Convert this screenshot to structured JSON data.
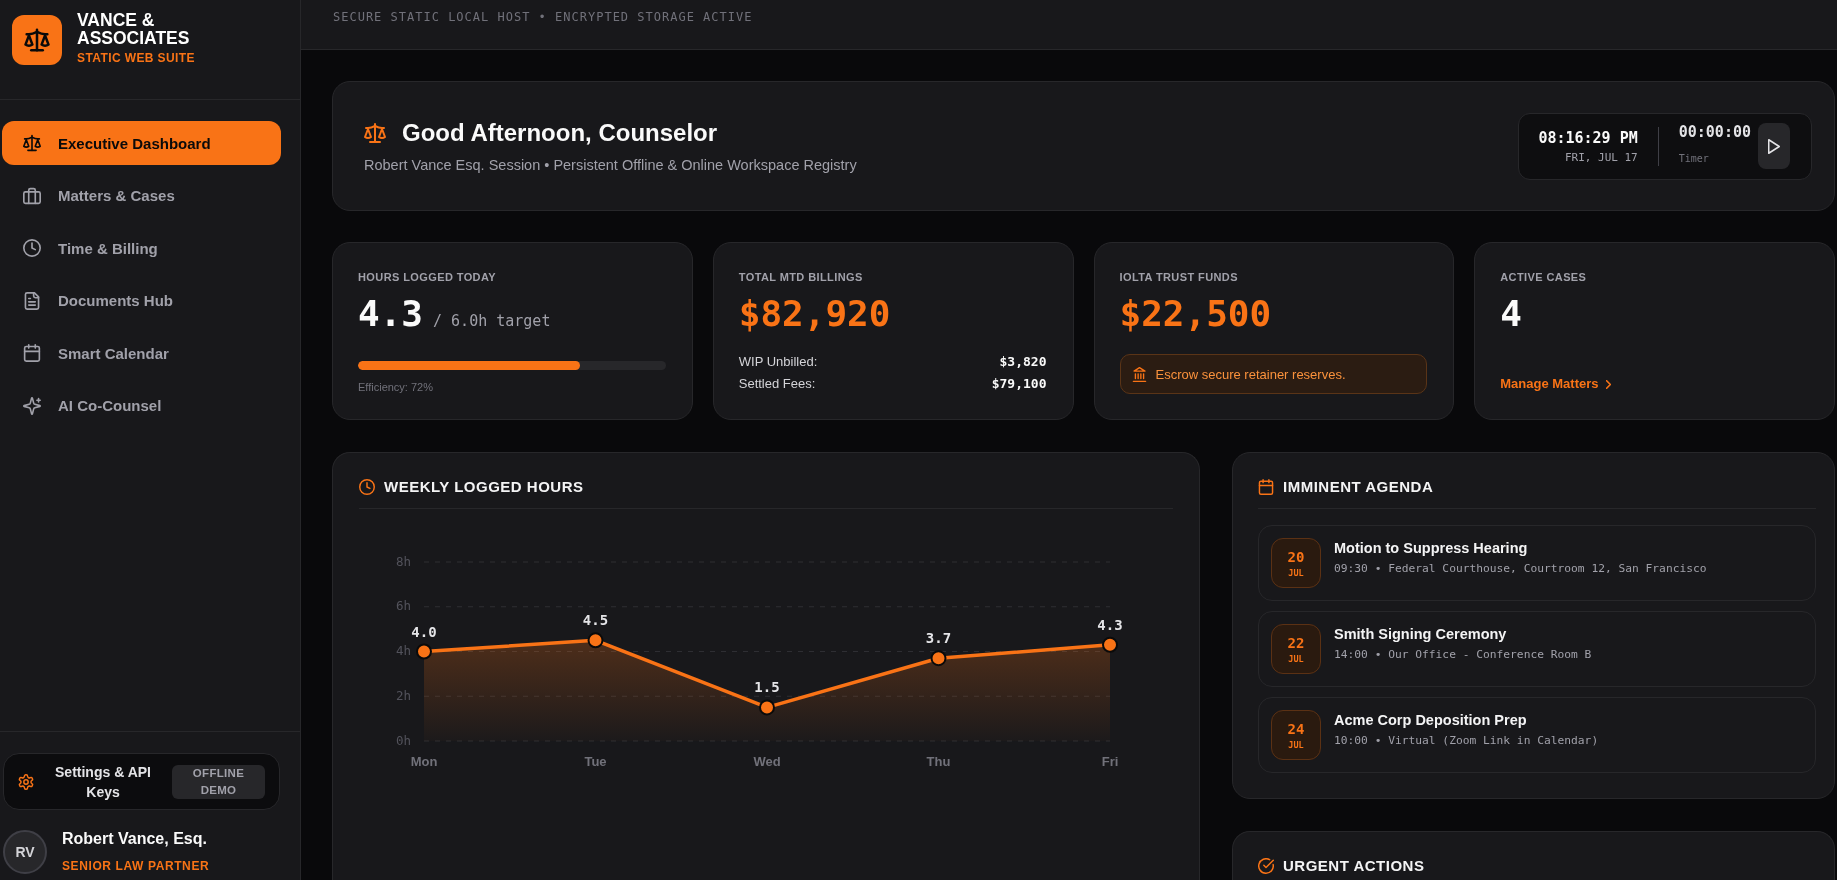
{
  "sidebar": {
    "brand": {
      "name": "VANCE & ASSOCIATES",
      "tagline": "STATIC WEB SUITE"
    },
    "nav": [
      {
        "label": "Executive Dashboard",
        "selected": true
      },
      {
        "label": "Matters & Cases",
        "selected": false
      },
      {
        "label": "Time & Billing",
        "selected": false
      },
      {
        "label": "Documents Hub",
        "selected": false
      },
      {
        "label": "Smart Calendar",
        "selected": false
      },
      {
        "label": "AI Co-Counsel",
        "selected": false
      }
    ],
    "settings": {
      "label": "Settings & API Keys",
      "badge": "OFFLINE DEMO"
    },
    "user": {
      "initials": "RV",
      "name": "Robert Vance, Esq.",
      "role": "SENIOR LAW PARTNER"
    }
  },
  "top_bar": {
    "status": "SECURE STATIC LOCAL HOST • ENCRYPTED STORAGE ACTIVE"
  },
  "greeting": {
    "title": "Good Afternoon, Counselor",
    "subtitle": "Robert Vance Esq. Session • Persistent Offline & Online Workspace Registry",
    "clock": {
      "time": "08:16:29 PM",
      "date": "FRI, JUL 17"
    },
    "timer": {
      "value": "00:00:00",
      "label": "Timer"
    }
  },
  "stats": [
    {
      "kind": "progress",
      "label": "HOURS LOGGED TODAY",
      "value": "4.3",
      "unit": "/ 6.0h target",
      "level": 0.72,
      "caption": "Efficiency: 72%"
    },
    {
      "kind": "breakdown",
      "label": "TOTAL MTD BILLINGS",
      "value": "$82,920",
      "rows": [
        {
          "label": "WIP Unbilled:",
          "value": "$3,820"
        },
        {
          "label": "Settled Fees:",
          "value": "$79,100"
        }
      ]
    },
    {
      "kind": "notice",
      "label": "IOLTA TRUST FUNDS",
      "value": "$22,500",
      "notice": "Escrow secure retainer reserves."
    },
    {
      "kind": "link",
      "label": "ACTIVE CASES",
      "value": "4",
      "link": "Manage Matters"
    }
  ],
  "weekly_hours": {
    "title": "WEEKLY LOGGED HOURS",
    "chart_data": {
      "type": "area",
      "categories": [
        "Mon",
        "Tue",
        "Wed",
        "Thu",
        "Fri"
      ],
      "series": [
        {
          "color": "#f97316",
          "values": [
            4.0,
            4.5,
            1.5,
            3.7,
            4.3
          ]
        }
      ],
      "ylim": [
        0,
        8
      ],
      "yticks": [
        {
          "value": 0,
          "label": "0h"
        },
        {
          "value": 2,
          "label": "2h"
        },
        {
          "value": 4,
          "label": "4h"
        },
        {
          "value": 6,
          "label": "6h"
        },
        {
          "value": 8,
          "label": "8h"
        }
      ],
      "grid": true,
      "value_labels": [
        "4.0",
        "4.5",
        "1.5",
        "3.7",
        "4.3"
      ]
    }
  },
  "agenda": {
    "title": "IMMINENT AGENDA",
    "items": [
      {
        "day": "20",
        "month": "JUL",
        "title": "Motion to Suppress Hearing",
        "detail": "09:30 • Federal Courthouse, Courtroom 12, San Francisco"
      },
      {
        "day": "22",
        "month": "JUL",
        "title": "Smith Signing Ceremony",
        "detail": "14:00 • Our Office - Conference Room B"
      },
      {
        "day": "24",
        "month": "JUL",
        "title": "Acme Corp Deposition Prep",
        "detail": "10:00 • Virtual (Zoom Link in Calendar)"
      }
    ]
  },
  "urgent_actions": {
    "title": "URGENT ACTIONS"
  }
}
